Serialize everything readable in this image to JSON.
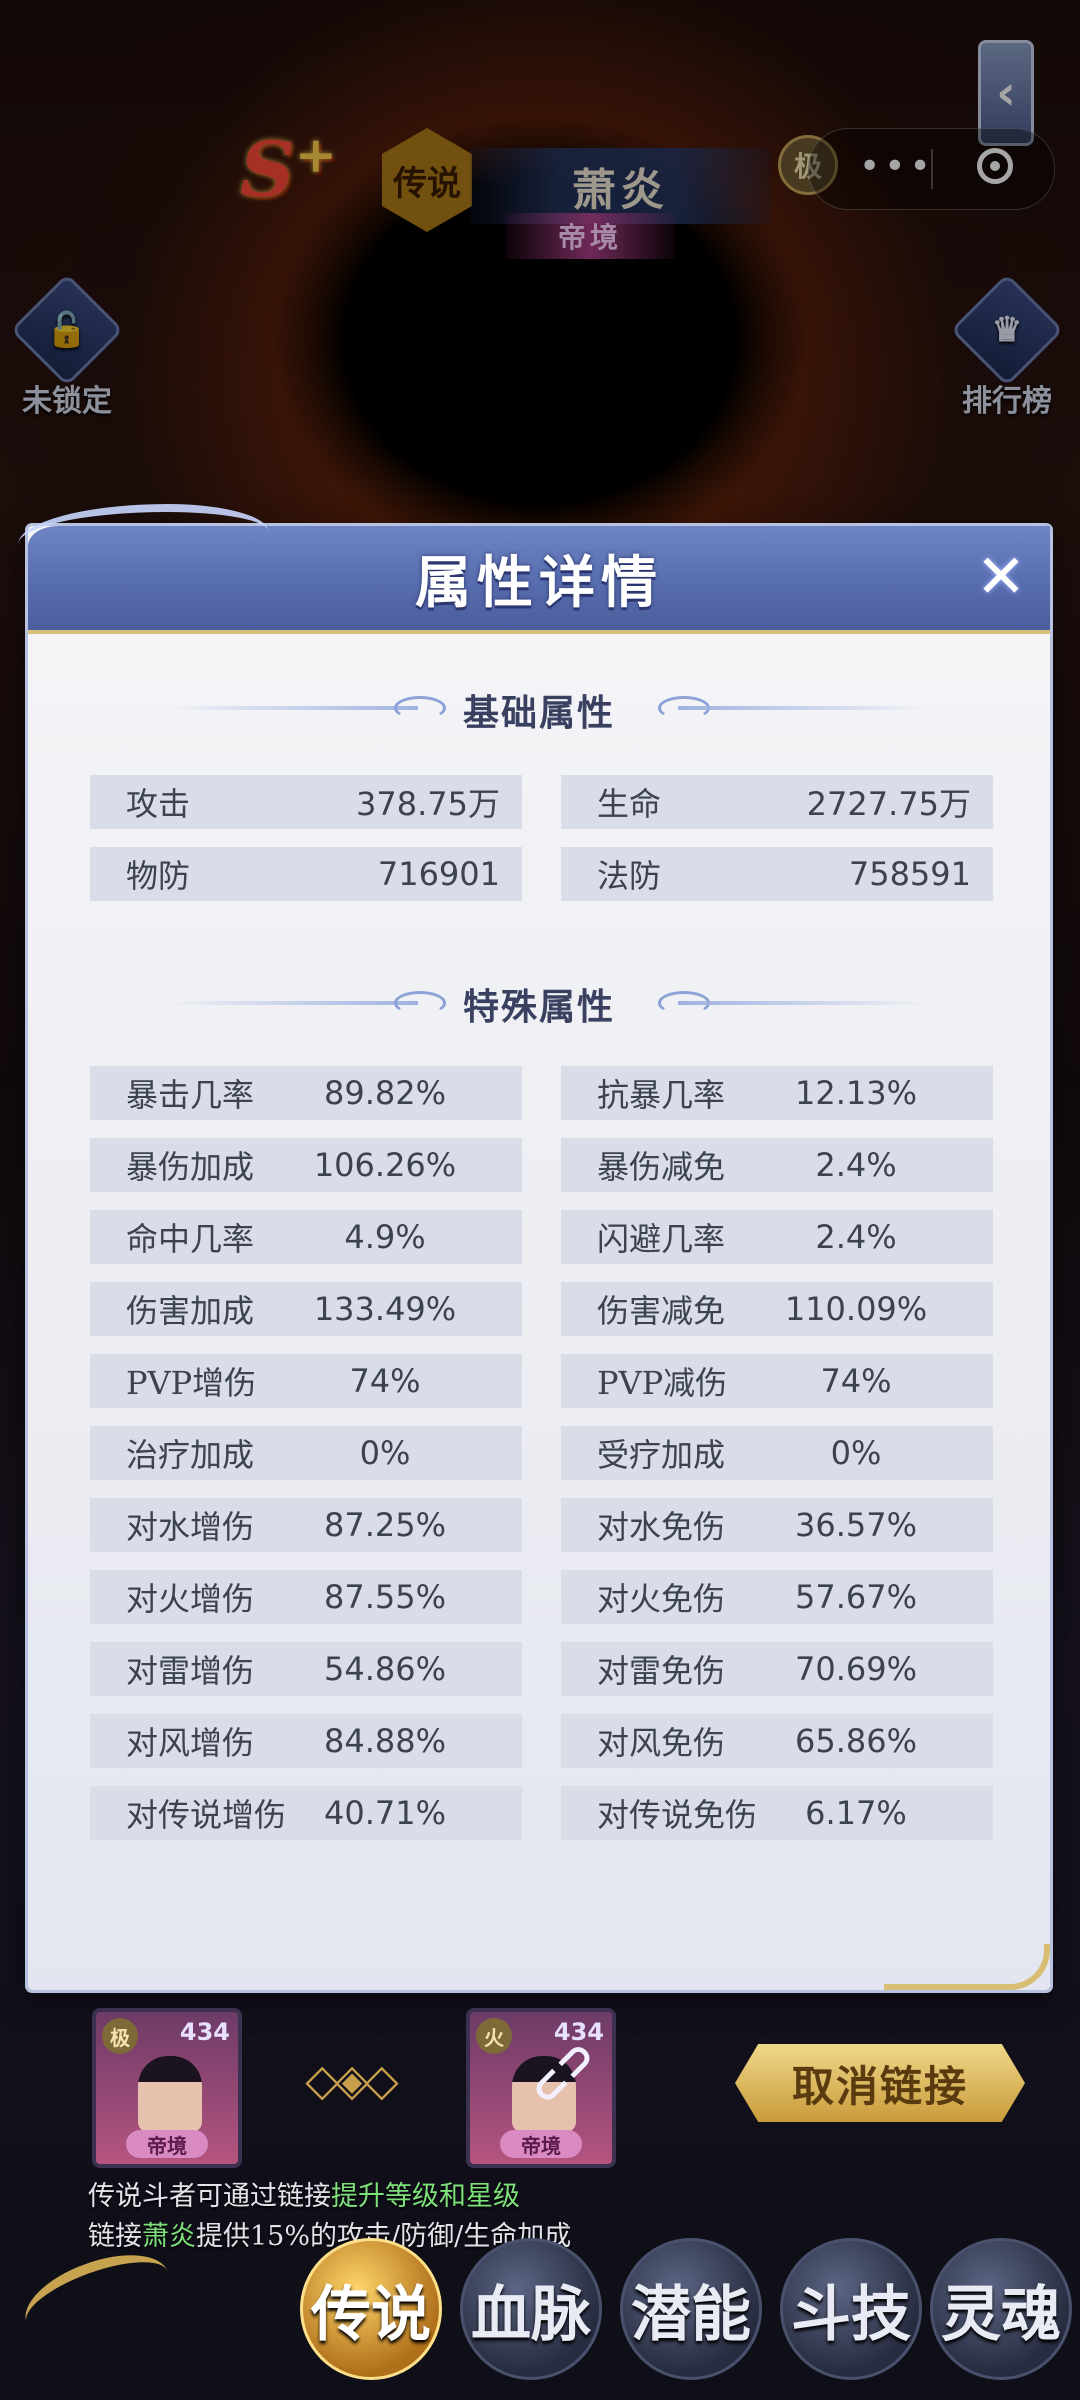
{
  "hero": {
    "grade": "S",
    "grade_plus": "+",
    "rarity": "传说",
    "name": "萧炎",
    "title": "帝境",
    "level_tag": "极"
  },
  "side_buttons": {
    "lock_label": "未锁定",
    "rank_label": "排行榜"
  },
  "modal": {
    "title": "属性详情",
    "close_symbol": "✕",
    "basic_section_title": "基础属性",
    "basic": [
      {
        "label": "攻击",
        "value": "378.75万"
      },
      {
        "label": "生命",
        "value": "2727.75万"
      },
      {
        "label": "物防",
        "value": "716901"
      },
      {
        "label": "法防",
        "value": "758591"
      }
    ],
    "special_section_title": "特殊属性",
    "special": [
      {
        "label": "暴击几率",
        "value": "89.82%"
      },
      {
        "label": "抗暴几率",
        "value": "12.13%"
      },
      {
        "label": "暴伤加成",
        "value": "106.26%"
      },
      {
        "label": "暴伤减免",
        "value": "2.4%"
      },
      {
        "label": "命中几率",
        "value": "4.9%"
      },
      {
        "label": "闪避几率",
        "value": "2.4%"
      },
      {
        "label": "伤害加成",
        "value": "133.49%"
      },
      {
        "label": "伤害减免",
        "value": "110.09%"
      },
      {
        "label": "PVP增伤",
        "value": "74%"
      },
      {
        "label": "PVP减伤",
        "value": "74%"
      },
      {
        "label": "治疗加成",
        "value": "0%"
      },
      {
        "label": "受疗加成",
        "value": "0%"
      },
      {
        "label": "对水增伤",
        "value": "87.25%"
      },
      {
        "label": "对水免伤",
        "value": "36.57%"
      },
      {
        "label": "对火增伤",
        "value": "87.55%"
      },
      {
        "label": "对火免伤",
        "value": "57.67%"
      },
      {
        "label": "对雷增伤",
        "value": "54.86%"
      },
      {
        "label": "对雷免伤",
        "value": "70.69%"
      },
      {
        "label": "对风增伤",
        "value": "84.88%"
      },
      {
        "label": "对风免伤",
        "value": "65.86%"
      },
      {
        "label": "对传说增伤",
        "value": "40.71%"
      },
      {
        "label": "对传说免伤",
        "value": "6.17%"
      }
    ]
  },
  "link": {
    "card1": {
      "tag": "极",
      "level": "434",
      "badge": "帝境"
    },
    "card2": {
      "tag": "火",
      "level": "434",
      "badge": "帝境"
    },
    "unlink_label": "取消链接",
    "hint1_prefix": "传说斗者可通过链接",
    "hint1_highlight": "提升等级和星级",
    "hint2_prefix": "链接",
    "hint2_highlight": "萧炎",
    "hint2_suffix": "提供15%的攻击/防御/生命加成"
  },
  "tabs": [
    {
      "label": "传说",
      "icon": "legend-tab-icon"
    },
    {
      "label": "血脉",
      "icon": "bloodline-tab-icon"
    },
    {
      "label": "潜能",
      "icon": "potential-tab-icon"
    },
    {
      "label": "斗技",
      "icon": "skill-tab-icon"
    },
    {
      "label": "灵魂",
      "icon": "soul-tab-icon"
    }
  ],
  "colors": {
    "modal_header": "#5a6fb0",
    "cell_bg": "#d9dde8",
    "gold": "#d7be73",
    "hint_green": "#7ee07a"
  }
}
